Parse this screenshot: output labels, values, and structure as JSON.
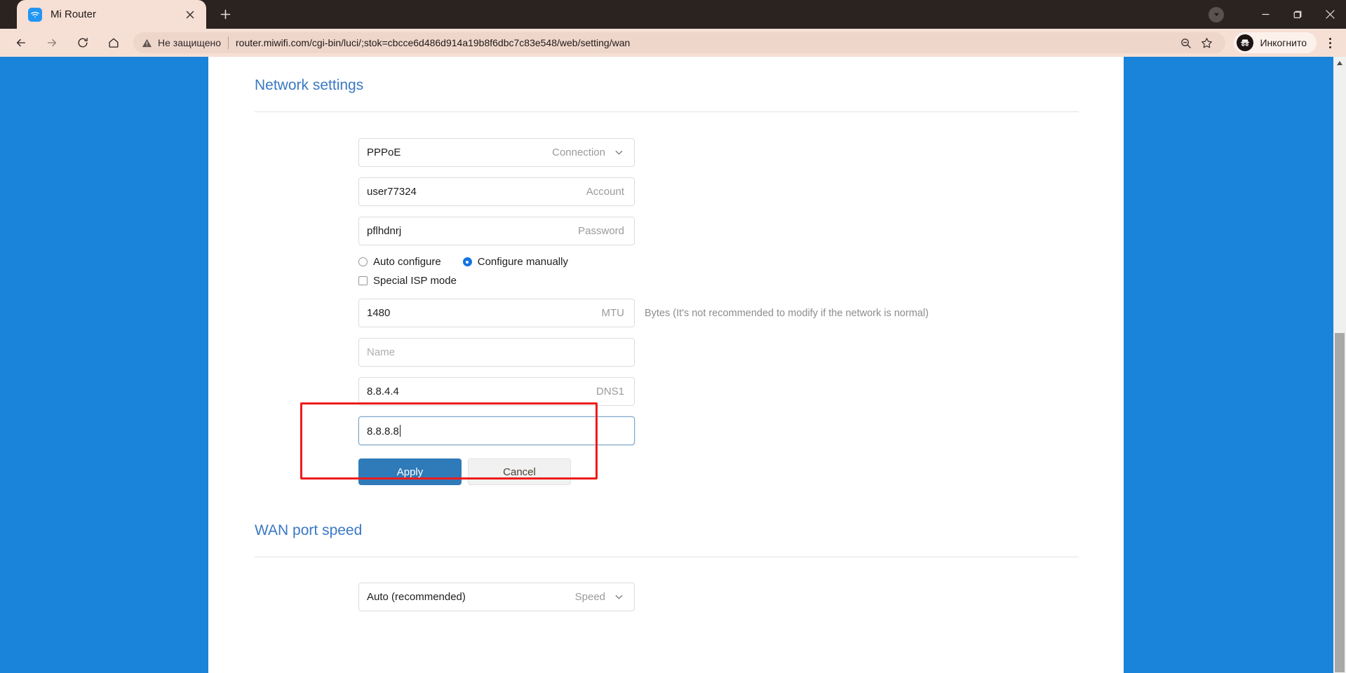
{
  "browser": {
    "tab": {
      "title": "Mi Router",
      "favicon_icon": "wifi-icon",
      "close_icon": "close-icon"
    },
    "newtab_icon": "plus-icon",
    "window": {
      "caret_icon": "chevron-down-icon",
      "minimize_icon": "minimize-icon",
      "maximize_icon": "maximize-icon",
      "close_icon": "close-icon"
    },
    "toolbar": {
      "back_icon": "back-arrow-icon",
      "forward_icon": "forward-arrow-icon",
      "reload_icon": "reload-icon",
      "home_icon": "home-icon",
      "warning_icon": "warning-triangle-icon",
      "security_text": "Не защищено",
      "url": "router.miwifi.com/cgi-bin/luci/;stok=cbcce6d486d914a19b8f6dbc7c83e548/web/setting/wan",
      "zoom_out_icon": "zoom-out-icon",
      "bookmark_icon": "star-icon",
      "profile_icon": "incognito-icon",
      "profile_label": "Инкогнито",
      "menu_icon": "kebab-menu-icon"
    }
  },
  "colors": {
    "page_background": "#1a83da",
    "heading": "#3b78c3",
    "primary_button": "#2f7ab8",
    "highlight_border": "#ee1c1c",
    "radio_selected": "#1474e0",
    "focused_field_border": "#7fa8cc"
  },
  "page": {
    "sections": [
      {
        "title": "Network settings",
        "fields": [
          {
            "label": "Connection",
            "value": "PPPoE",
            "placeholder": "",
            "type": "select",
            "chevron_icon": "chevron-down-icon"
          },
          {
            "label": "Account",
            "value": "user77324",
            "placeholder": "",
            "type": "text"
          },
          {
            "label": "Password",
            "value": "pflhdnrj",
            "placeholder": "",
            "type": "text"
          }
        ],
        "radios": [
          {
            "label": "Auto configure",
            "selected": false
          },
          {
            "label": "Configure manually",
            "selected": true
          }
        ],
        "checkbox": {
          "label": "Special ISP mode",
          "checked": false
        },
        "mtu": {
          "label": "MTU",
          "value": "1480",
          "hint": "Bytes (It's not recommended to modify if the network is normal)"
        },
        "name_field": {
          "label": "",
          "value": "",
          "placeholder": "Name"
        },
        "dns": [
          {
            "label": "DNS1",
            "value": "8.8.4.4",
            "focused": false
          },
          {
            "label": "",
            "value": "8.8.8.8",
            "focused": true
          }
        ],
        "buttons": {
          "apply": "Apply",
          "cancel": "Cancel"
        }
      },
      {
        "title": "WAN port speed",
        "speed_field": {
          "label": "Speed",
          "value": "Auto (recommended)",
          "chevron_icon": "chevron-down-icon"
        }
      }
    ]
  },
  "scrollbar": {
    "up_arrow_icon": "caret-up-icon"
  }
}
